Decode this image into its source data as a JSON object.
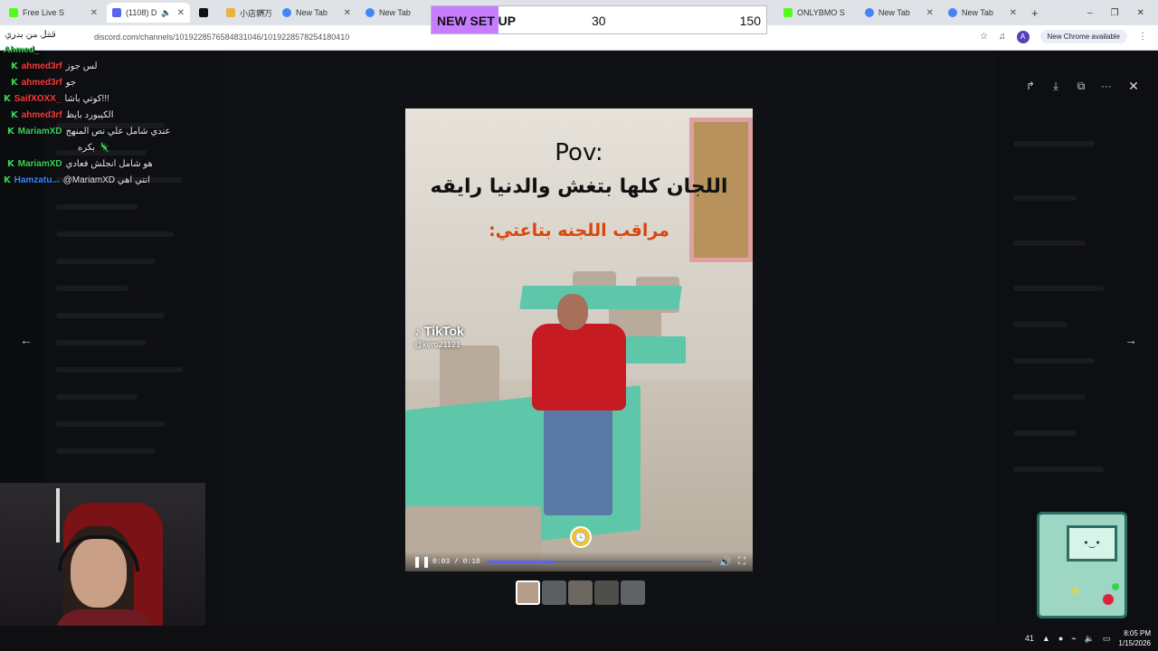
{
  "browser": {
    "tabs": [
      {
        "label": "Free Live S",
        "color": "#53fc18",
        "active": false
      },
      {
        "label": "(1108) D",
        "color": "#5865f2",
        "active": true
      },
      {
        "label": "",
        "color": "#111111",
        "active": false
      },
      {
        "label": "小店新万",
        "color": "#e7b43b",
        "active": false
      },
      {
        "label": "New Tab",
        "color": "#4285f4",
        "active": false
      },
      {
        "label": "New Tab",
        "color": "#4285f4",
        "active": false
      },
      {
        "label": "ONLYBMO S",
        "color": "#53fc18",
        "active": false
      },
      {
        "label": "New Tab",
        "color": "#4285f4",
        "active": false
      },
      {
        "label": "New Tab",
        "color": "#4285f4",
        "active": false
      }
    ],
    "url": "discord.com/channels/1019228576584831046/1019228578254180410",
    "profile_initial": "A",
    "update_label": "New Chrome available"
  },
  "goal": {
    "label": "NEW SET UP",
    "current": "30",
    "target": "150",
    "progress_fraction": 0.2,
    "fill_color": "#c77dff"
  },
  "chat": [
    {
      "user": "",
      "message": "قفل من بدري",
      "color": "#ffffff"
    },
    {
      "user": "Ahmed_",
      "message": "",
      "color": "#3bd35a"
    },
    {
      "user": "ahmed3rf",
      "message": "لس جوز",
      "color": "#ff3b3b"
    },
    {
      "user": "ahmed3rf",
      "message": "جو",
      "color": "#ff3b3b"
    },
    {
      "user": "SaifXOXX_",
      "message": "كوتي باشا!!!",
      "color": "#ff3b3b"
    },
    {
      "user": "ahmed3rf",
      "message": "الكيبورد بايظ",
      "color": "#ff3b3b"
    },
    {
      "user": "MariamXD",
      "message": "عندي شامل علي نص المنهج",
      "color": "#3bd35a"
    },
    {
      "user": "",
      "message": "بكره",
      "color": "#ffffff"
    },
    {
      "user": "MariamXD",
      "message": "هو شامل انجلش فعادي",
      "color": "#3bd35a"
    },
    {
      "user": "Hamzatu...",
      "message": "@MariamXD انتي اهي",
      "color": "#3b8bff"
    }
  ],
  "video": {
    "caption_pov": "Pov:",
    "caption_main": "اللجان كلها بتغش والدنيا رايقه",
    "caption_sub": "مراقب اللجنه بتاعتي:",
    "watermark_brand": "TikTok",
    "watermark_handle": "@kero21121",
    "timecode": "0:03 / 0:10",
    "progress_fraction": 0.3,
    "accent": "#5865f2"
  },
  "thumbnails": 5,
  "taskbar": {
    "tray_badge": "41",
    "time": "8:05 PM",
    "date": "1/15/2026"
  }
}
